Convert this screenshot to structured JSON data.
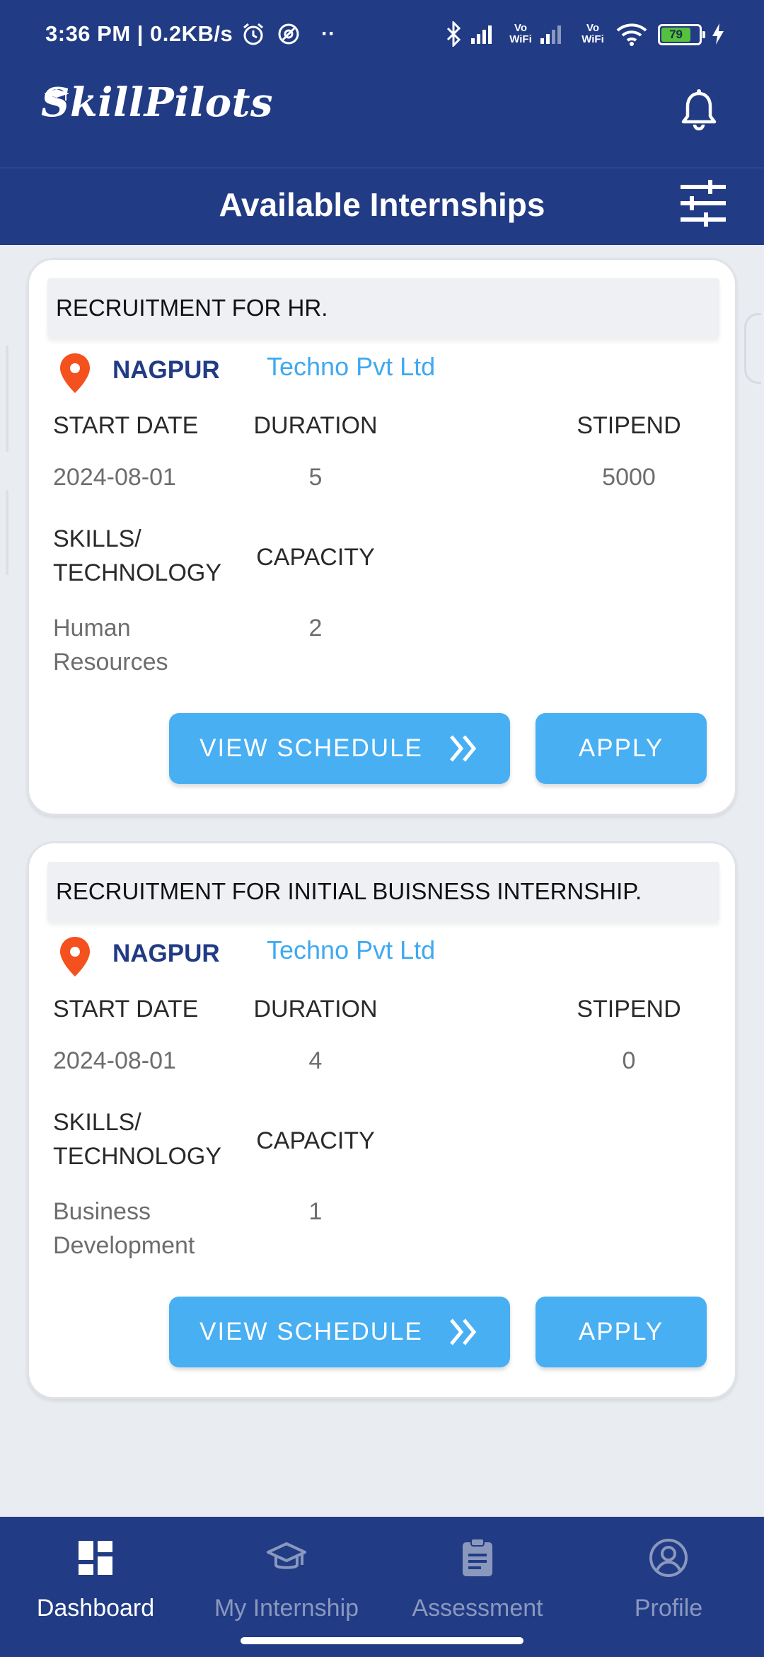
{
  "status_bar": {
    "time_speed": "3:36 PM | 0.2KB/s",
    "vo_wifi_1": "Vo WiFi",
    "vo_wifi_2": "Vo WiFi",
    "battery": "79"
  },
  "app": {
    "logo": "SkillPilots"
  },
  "page": {
    "title": "Available Internships"
  },
  "labels": {
    "start_date": "START DATE",
    "duration": "DURATION",
    "stipend": "STIPEND",
    "skills": "SKILLS/ TECHNOLOGY",
    "capacity": "CAPACITY",
    "view_schedule": "VIEW SCHEDULE",
    "apply": "APPLY"
  },
  "internships": [
    {
      "title": "RECRUITMENT FOR HR.",
      "location": "NAGPUR",
      "company": "Techno Pvt Ltd",
      "start_date": "2024-08-01",
      "duration": "5",
      "stipend": "5000",
      "skills": "Human Resources",
      "capacity": "2"
    },
    {
      "title": "RECRUITMENT FOR INITIAL BUISNESS INTERNSHIP.",
      "location": "NAGPUR",
      "company": "Techno Pvt Ltd",
      "start_date": "2024-08-01",
      "duration": "4",
      "stipend": "0",
      "skills": "Business Development",
      "capacity": "1"
    }
  ],
  "bottom_nav": [
    {
      "label": "Dashboard",
      "icon": "dashboard-icon",
      "active": true
    },
    {
      "label": "My Internship",
      "icon": "graduation-cap-icon",
      "active": false
    },
    {
      "label": "Assessment",
      "icon": "clipboard-icon",
      "active": false
    },
    {
      "label": "Profile",
      "icon": "profile-icon",
      "active": false
    }
  ],
  "colors": {
    "brand_navy": "#213b85",
    "button_blue": "#48aff3",
    "company_link": "#3fa9f0",
    "pin_orange": "#f4511e",
    "background": "#e9ecf1"
  }
}
